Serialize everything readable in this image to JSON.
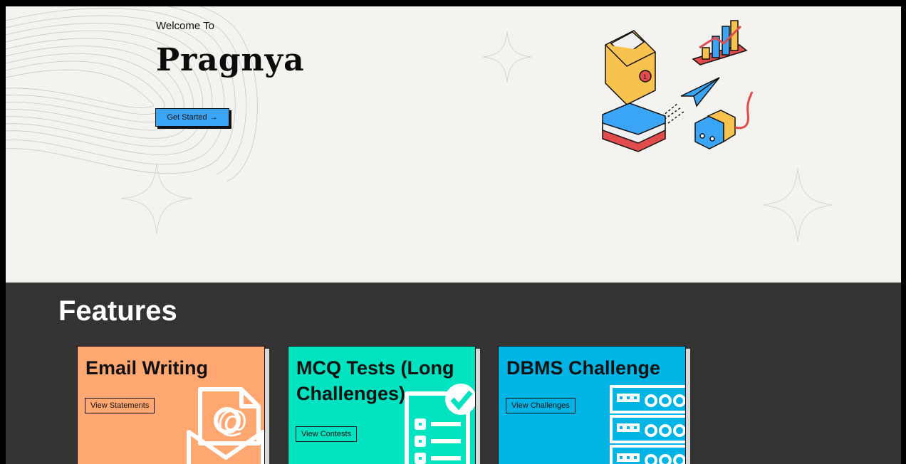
{
  "hero": {
    "welcome": "Welcome To",
    "brand": "Pragnya",
    "cta_label": "Get Started",
    "cta_arrow": "→"
  },
  "features": {
    "heading": "Features",
    "cards": [
      {
        "title": "Email Writing",
        "button": "View Statements",
        "color": "#ffa770",
        "icon": "email-at-icon"
      },
      {
        "title": "MCQ Tests (Long Challenges)",
        "button": "View Contests",
        "color": "#00e3c0",
        "icon": "checklist-icon"
      },
      {
        "title": "DBMS Challenge",
        "button": "View Challenges",
        "color": "#00b4e6",
        "icon": "server-rack-icon"
      }
    ]
  }
}
